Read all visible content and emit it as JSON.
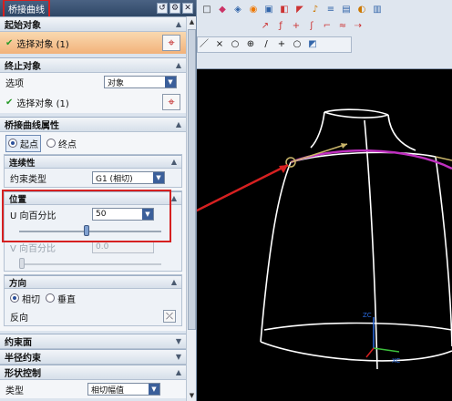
{
  "dialog": {
    "title": "桥接曲线",
    "title_icons": [
      "reset-icon",
      "gear-icon",
      "close-icon"
    ]
  },
  "start_object": {
    "header": "起始对象",
    "select_label": "选择对象 (1)"
  },
  "end_object": {
    "header": "终止对象",
    "option_label": "选项",
    "option_value": "对象",
    "select_label": "选择对象 (1)"
  },
  "bridge_props": {
    "header": "桥接曲线属性",
    "start_point": "起点",
    "end_point": "终点",
    "continuity": {
      "header": "连续性",
      "constraint_label": "约束类型",
      "constraint_value": "G1 (相切)"
    },
    "position": {
      "header": "位置",
      "u_label": "U 向百分比",
      "u_value": "50",
      "u_fraction": 0.5,
      "v_label": "V 向百分比",
      "v_value": "0.0"
    },
    "direction": {
      "header": "方向",
      "tangent": "相切",
      "vertical": "垂直",
      "reverse_label": "反向"
    }
  },
  "collapsed_sections": [
    "约束面",
    "半径约束",
    "形状控制"
  ],
  "shape_control": {
    "type_label": "类型",
    "type_value": "相切幅值"
  },
  "colors": {
    "accent_red": "#d62020",
    "selected_row": "#f2b27a",
    "bridge_curve": "#c030c0",
    "wireframe": "#ffffff"
  }
}
